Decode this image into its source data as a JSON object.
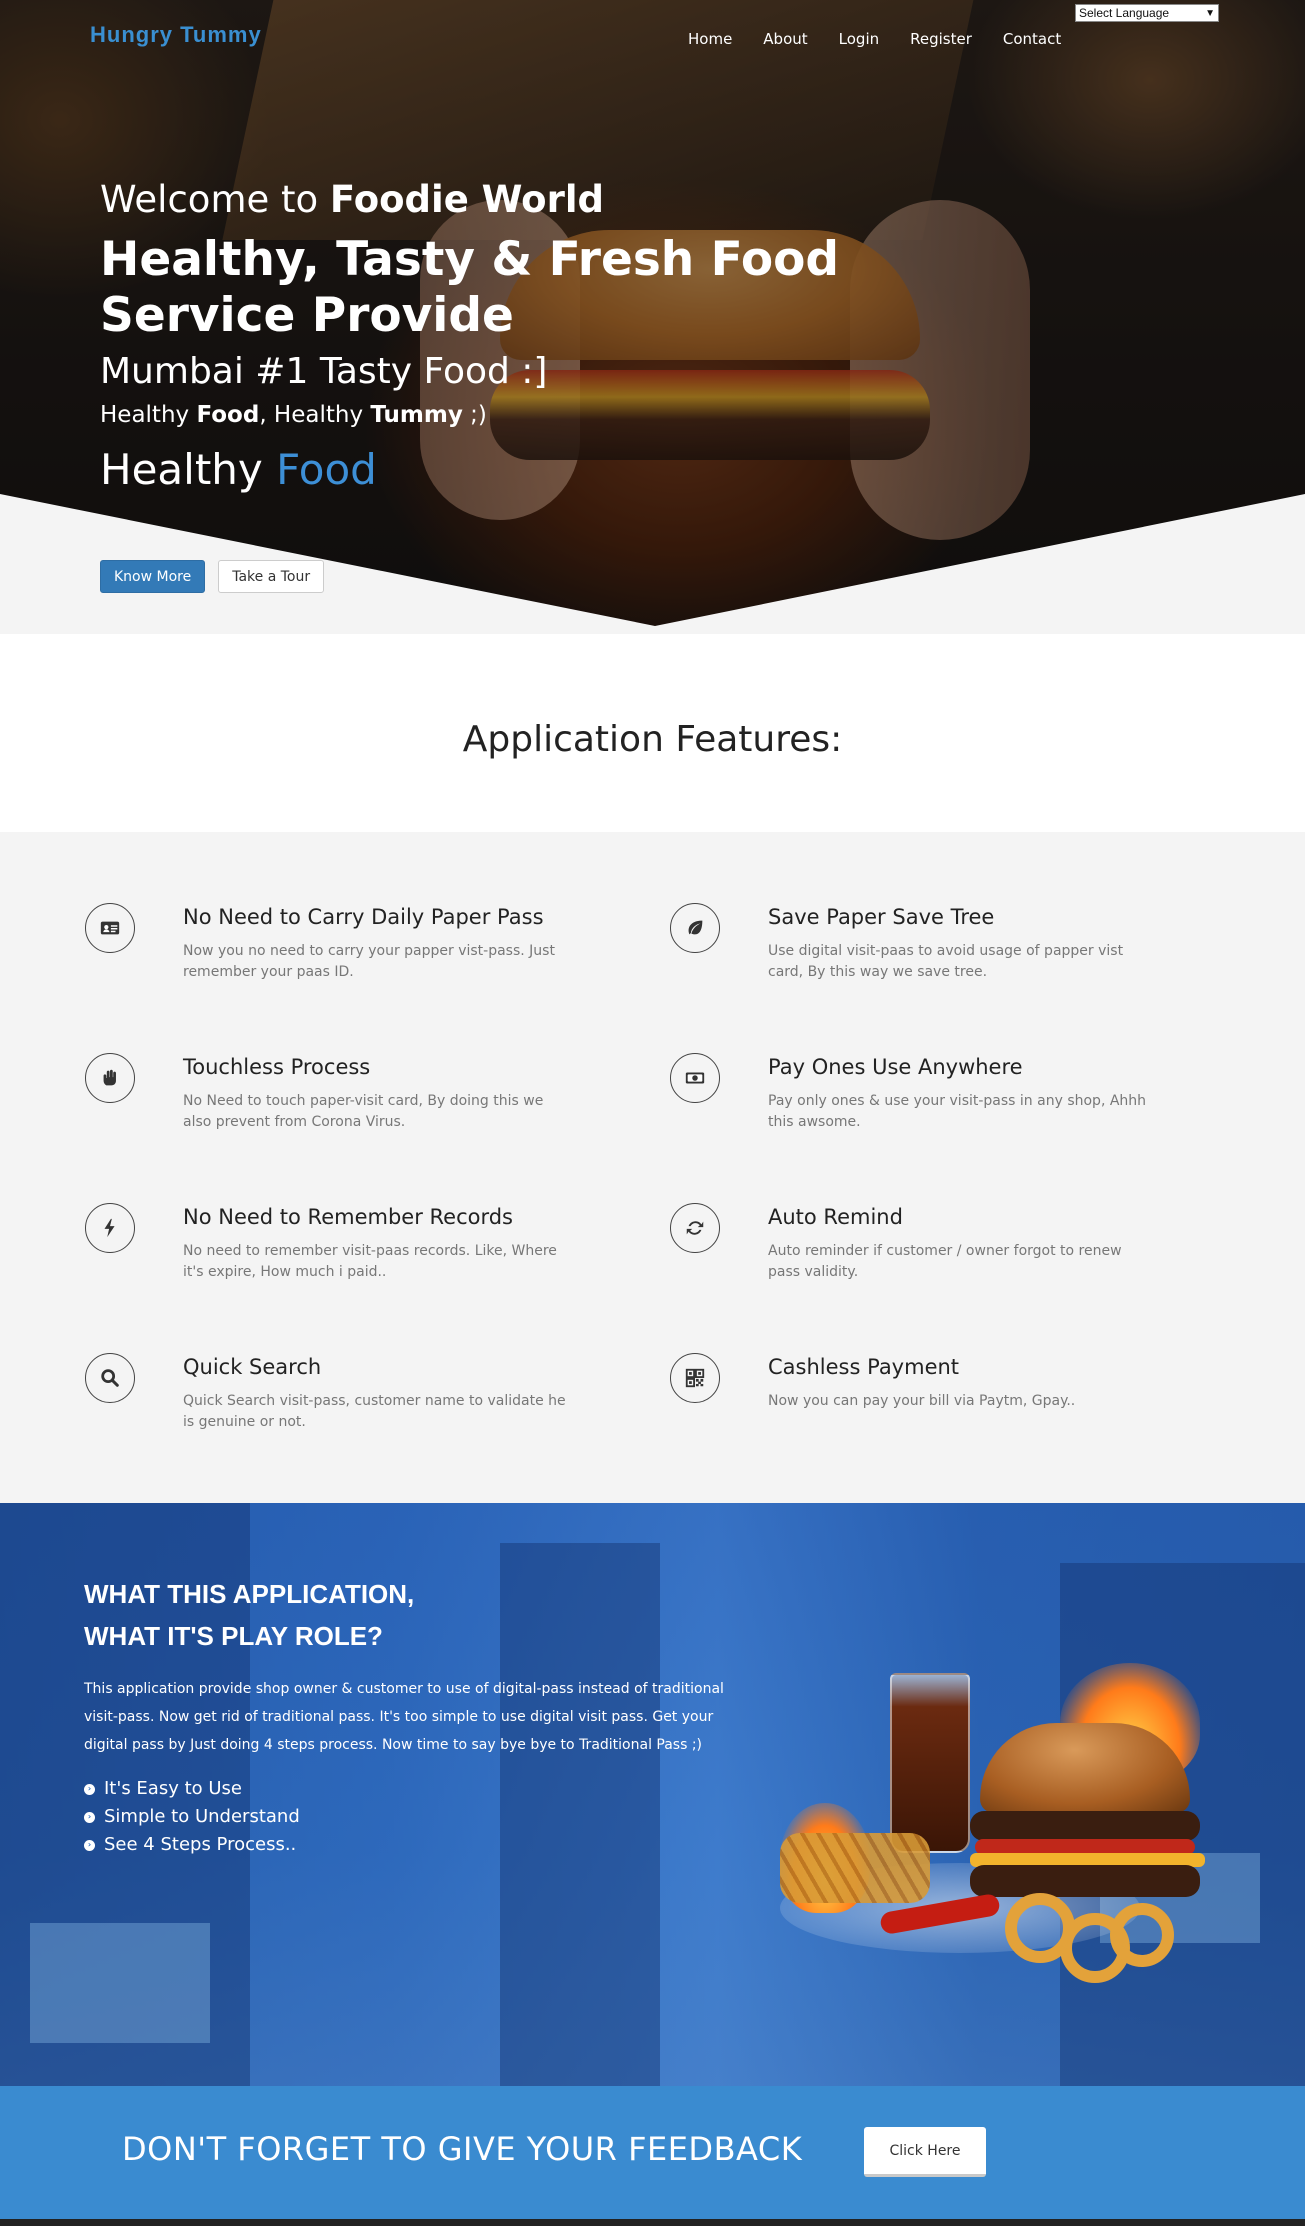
{
  "header": {
    "brand": "Hungry Tummy",
    "nav": [
      "Home",
      "About",
      "Login",
      "Register",
      "Contact"
    ],
    "language_select": "Select Language"
  },
  "hero": {
    "welcome_prefix": "Welcome to ",
    "welcome_bold": "Foodie World",
    "headline_line1": "Healthy, Tasty & Fresh Food",
    "headline_line2": "Service Provide",
    "city": "Mumbai #1 Tasty Food :]",
    "tag_1": "Healthy ",
    "tag_2": "Food",
    "tag_3": ", Healthy ",
    "tag_4": "Tummy",
    "tag_5": " ;)",
    "typed_prefix": "Healthy ",
    "typed_word": "Food",
    "accent_color": "#3d8fd6",
    "btn_know_more": "Know More",
    "btn_tour": "Take a Tour"
  },
  "features": {
    "title": "Application Features:",
    "items": [
      {
        "icon": "id-card-icon",
        "title": "No Need to Carry Daily Paper Pass",
        "desc": "Now you no need to carry your papper vist-pass. Just remember your paas ID."
      },
      {
        "icon": "leaf-icon",
        "title": "Save Paper Save Tree",
        "desc": "Use digital visit-paas to avoid usage of papper vist card, By this way we save tree."
      },
      {
        "icon": "hand-icon",
        "title": "Touchless Process",
        "desc": "No Need to touch paper-visit card, By doing this we also prevent from Corona Virus."
      },
      {
        "icon": "money-icon",
        "title": "Pay Ones Use Anywhere",
        "desc": "Pay only ones & use your visit-pass in any shop, Ahhh this awsome."
      },
      {
        "icon": "bolt-icon",
        "title": "No Need to Remember Records",
        "desc": "No need to remember visit-paas records. Like, Where it's expire, How much i paid.."
      },
      {
        "icon": "refresh-icon",
        "title": "Auto Remind",
        "desc": "Auto reminder if customer / owner forgot to renew pass validity."
      },
      {
        "icon": "search-icon",
        "title": "Quick Search",
        "desc": "Quick Search visit-pass, customer name to validate he is genuine or not."
      },
      {
        "icon": "qrcode-icon",
        "title": "Cashless Payment",
        "desc": "Now you can pay your bill via Paytm, Gpay.."
      }
    ]
  },
  "role": {
    "heading_line1": "WHAT THIS APPLICATION,",
    "heading_line2": "WHAT IT'S PLAY ROLE?",
    "description": "This application provide shop owner & customer to use of digital-pass instead of traditional visit-pass. Now get rid of traditional pass. It's too simple to use digital visit pass. Get your digital pass by Just doing 4 steps process. Now time to say bye bye to Traditional Pass ;)",
    "points": [
      "It's Easy to Use",
      "Simple to Understand",
      "See 4 Steps Process.."
    ]
  },
  "feedback": {
    "heading": "DON'T FORGET TO GIVE YOUR FEEDBACK",
    "button": "Click Here",
    "band_color": "#3a8bd0"
  }
}
